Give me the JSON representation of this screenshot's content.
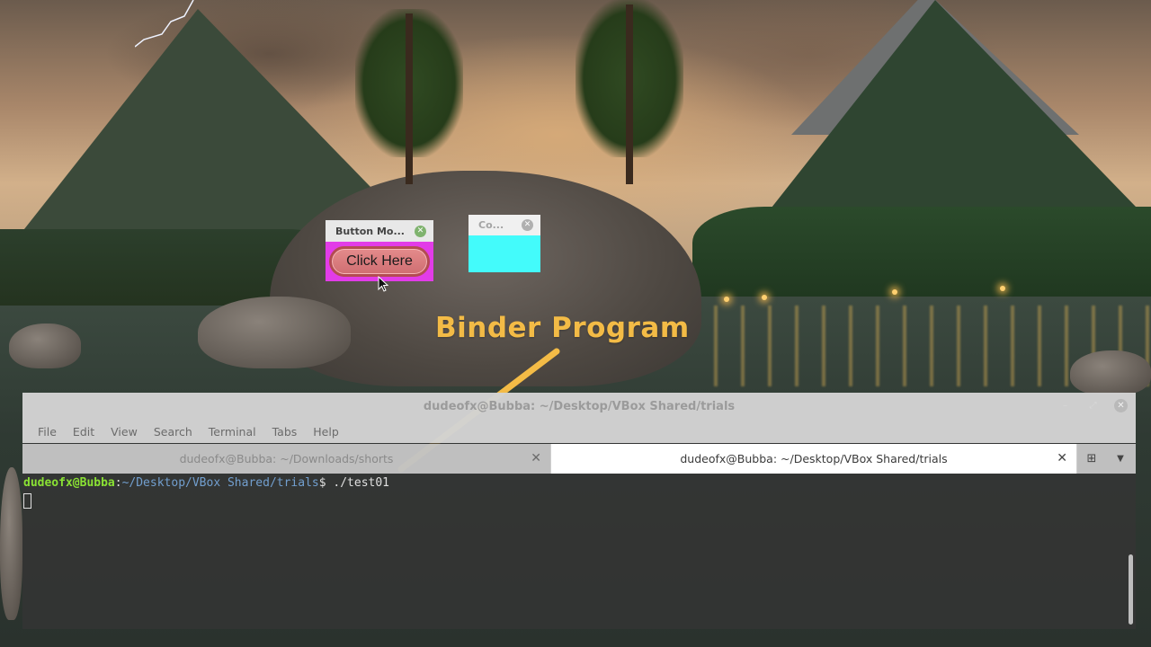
{
  "desktop": {
    "annotation": "Binder Program"
  },
  "button_window": {
    "title": "Button Mo...",
    "close_glyph": "✕",
    "button_label": "Click Here",
    "colors": {
      "body": "#e23ce8",
      "button": "#d97c7e"
    }
  },
  "color_window": {
    "title": "Co...",
    "close_glyph": "✕",
    "colors": {
      "body": "#43fbfb"
    }
  },
  "terminal": {
    "title": "dudeofx@Bubba: ~/Desktop/VBox Shared/trials",
    "controls": {
      "minimize": "–",
      "maximize": "⤢",
      "close": "✕"
    },
    "menu": [
      "File",
      "Edit",
      "View",
      "Search",
      "Terminal",
      "Tabs",
      "Help"
    ],
    "tabs": [
      {
        "label": "dudeofx@Bubba: ~/Downloads/shorts",
        "close": "✕",
        "active": false
      },
      {
        "label": "dudeofx@Bubba: ~/Desktop/VBox Shared/trials",
        "close": "✕",
        "active": true
      }
    ],
    "tab_tools": {
      "new_tab": "⊞",
      "dropdown": "▼"
    },
    "prompt": {
      "user_host": "dudeofx@Bubba",
      "separator": ":",
      "path": "~/Desktop/VBox Shared/trials",
      "symbol": "$",
      "command": " ./test01"
    },
    "colors": {
      "user": "#8ae234",
      "path": "#729fcf"
    }
  }
}
